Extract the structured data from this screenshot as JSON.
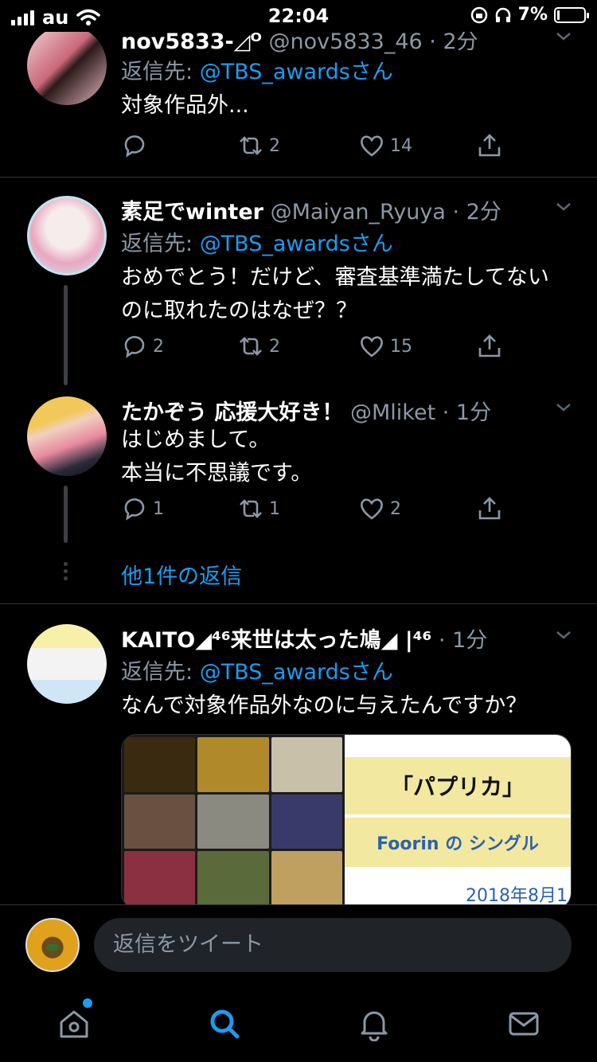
{
  "status_bar": {
    "carrier": "au",
    "time": "22:04",
    "battery": "7%"
  },
  "tweets": [
    {
      "name": "nov5833-◿ᴼ",
      "handle": "@nov5833_46",
      "time": "2分",
      "reply_label": "返信先: ",
      "reply_mention": "@TBS_awardsさん",
      "text": "対象作品外...",
      "replies": "",
      "retweets": "2",
      "likes": "14"
    },
    {
      "name": "素足でwinter",
      "handle": "@Maiyan_Ryuya",
      "time": "2分",
      "reply_label": "返信先: ",
      "reply_mention": "@TBS_awardsさん",
      "text": "おめでとう！だけど、審査基準満たしてないのに取れたのはなぜ？？",
      "replies": "2",
      "retweets": "2",
      "likes": "15"
    },
    {
      "name": "たかぞう 応援大好き！",
      "handle": "@Mliket",
      "time": "1分",
      "text": "はじめまして。\n本当に不思議です。",
      "replies": "1",
      "retweets": "1",
      "likes": "2"
    },
    {
      "name": "KAITO◢⁴⁶来世は太った鳩◢ |⁴⁶",
      "handle": "",
      "time": "1分",
      "reply_label": "返信先: ",
      "reply_mention": "@TBS_awardsさん",
      "text": "なんで対象作品外なのに与えたんですか？"
    }
  ],
  "more_replies": "他1件の返信",
  "card": {
    "wiki_title": "「パプリカ」",
    "wiki_sub": "Foorin の シングル",
    "wiki_date": "2018年8月1"
  },
  "compose": {
    "placeholder": "返信をツイート"
  },
  "tabs": [
    "home-icon",
    "search-icon",
    "notifications-icon",
    "messages-icon"
  ],
  "colors": {
    "accent": "#1d9bf0",
    "muted": "#8b98a5",
    "background": "#000000"
  }
}
